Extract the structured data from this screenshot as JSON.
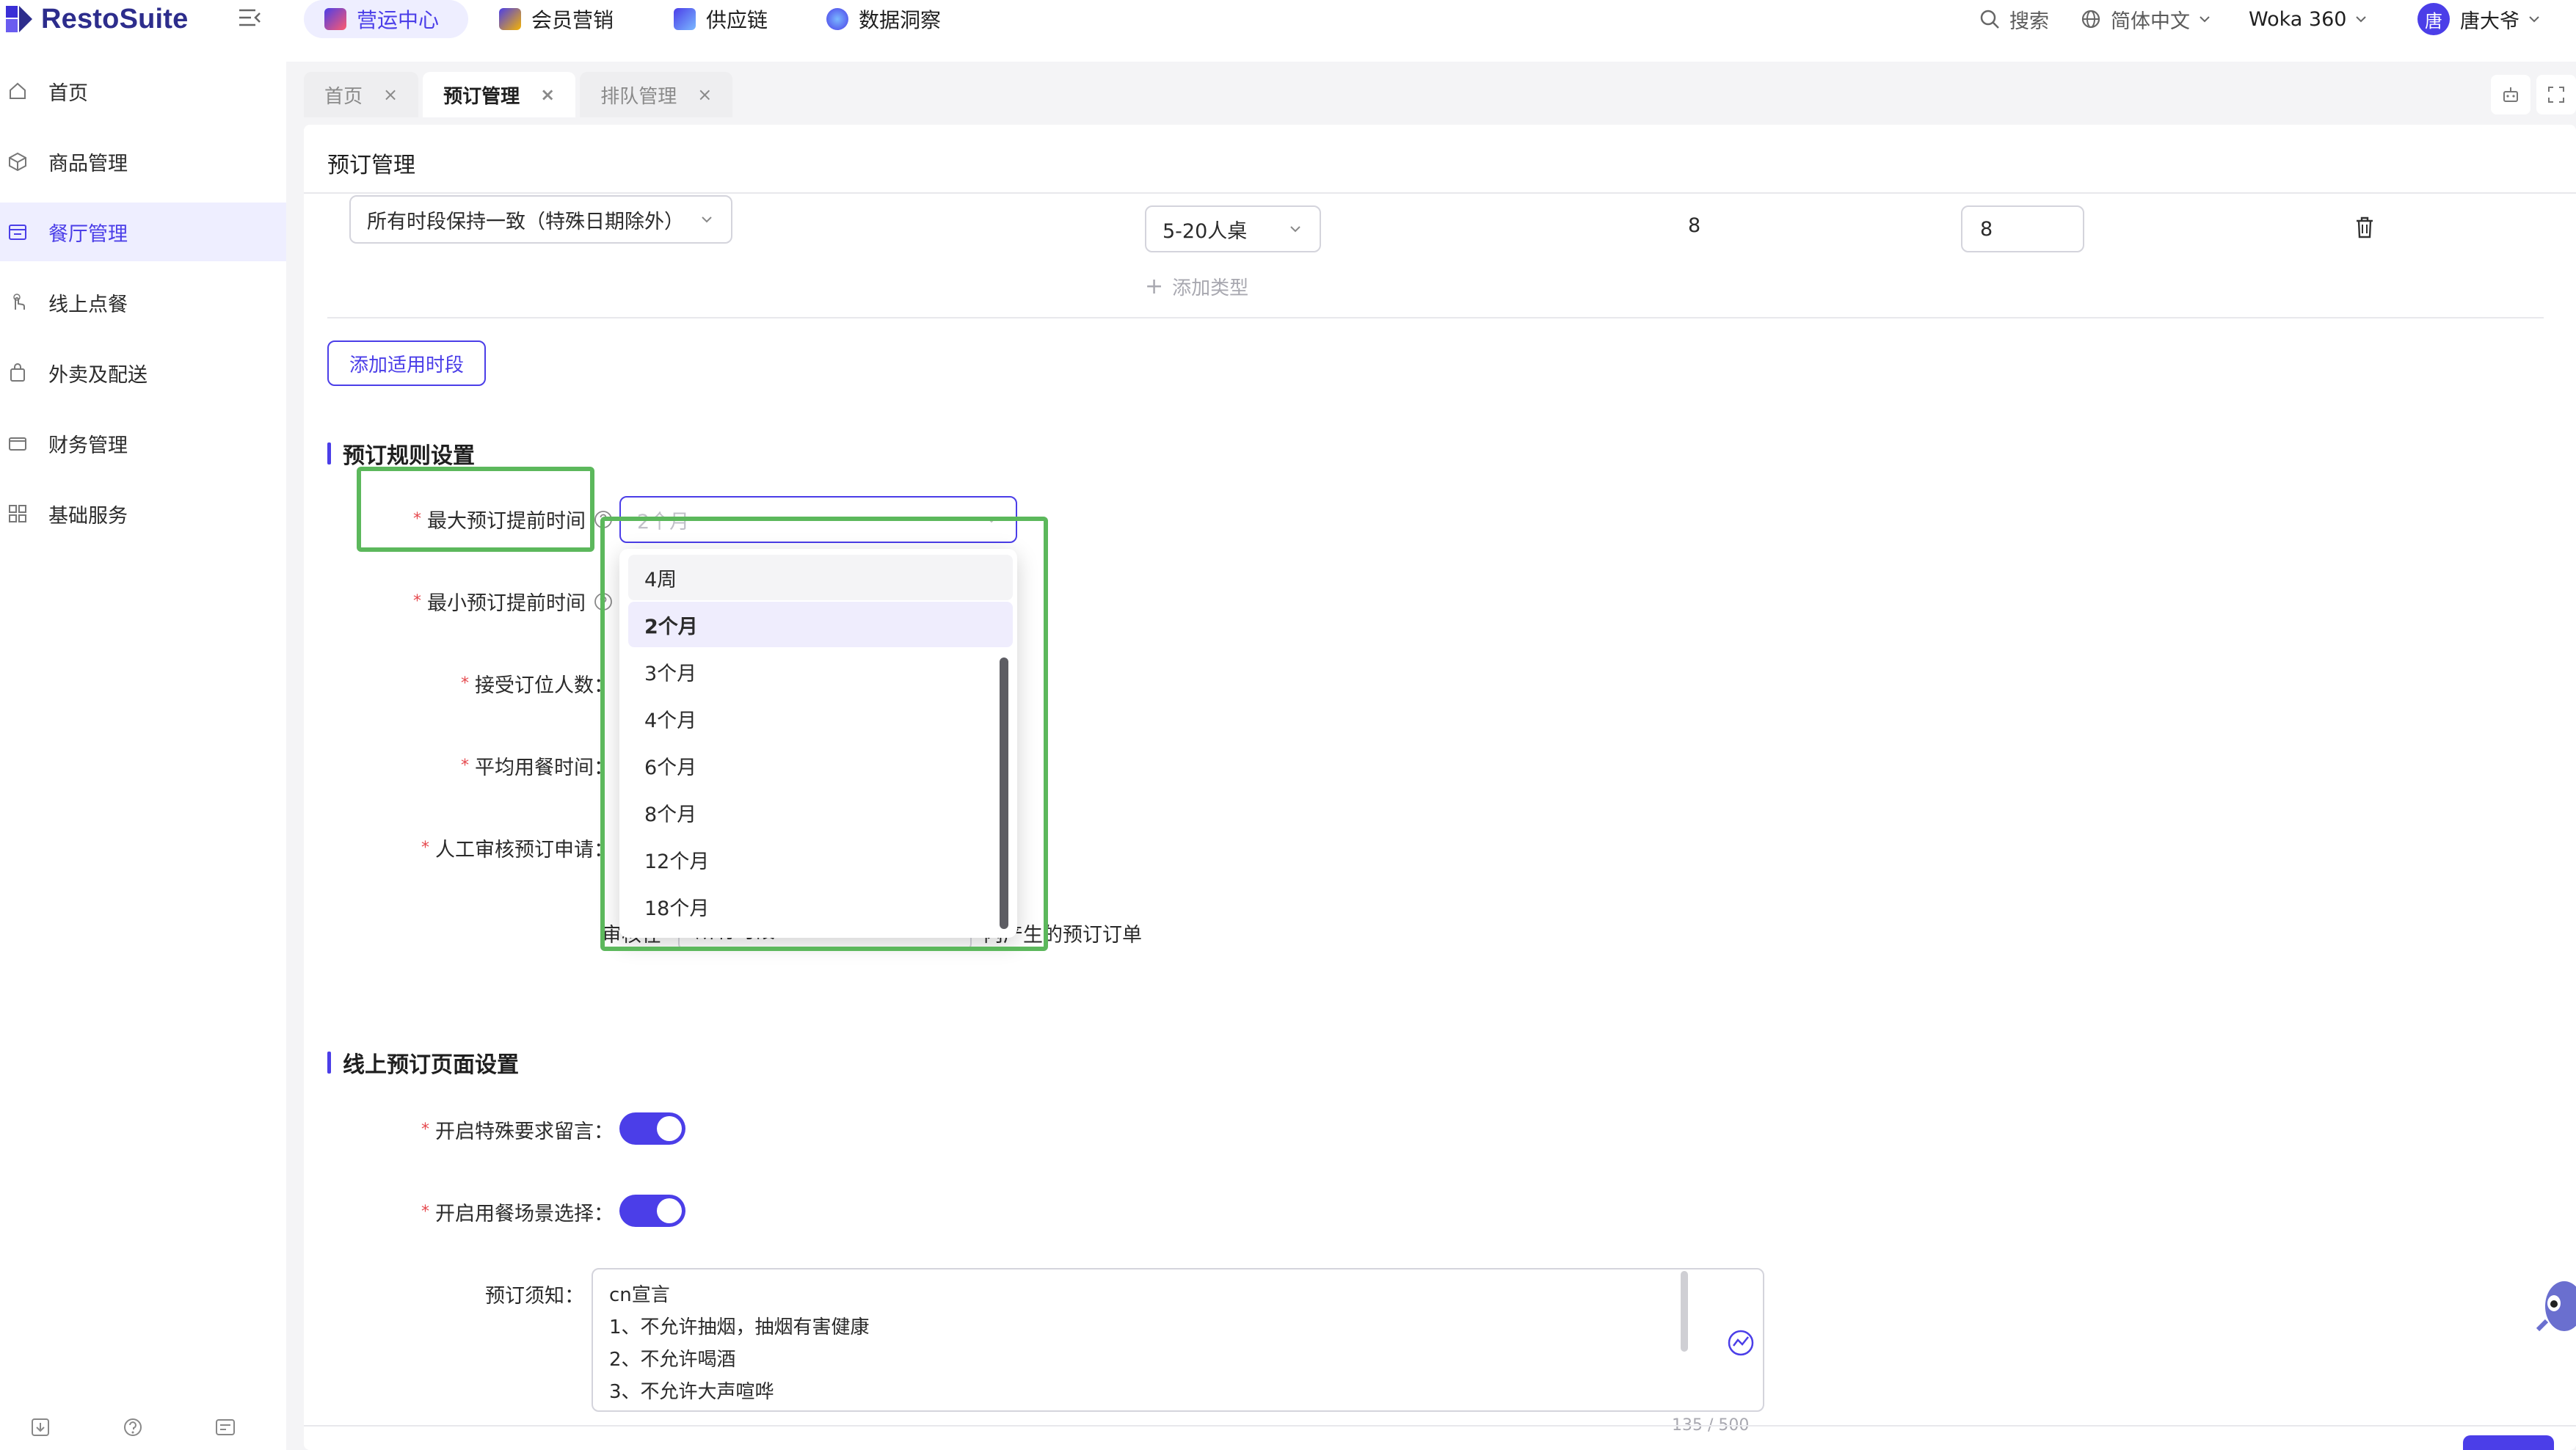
{
  "app": {
    "name": "RestoSuite"
  },
  "top_nav": [
    {
      "label": "营运中心",
      "active": true
    },
    {
      "label": "会员营销",
      "active": false
    },
    {
      "label": "供应链",
      "active": false
    },
    {
      "label": "数据洞察",
      "active": false
    }
  ],
  "top_right": {
    "search_label": "搜索",
    "language": "简体中文",
    "workspace": "Woka 360",
    "user_initial": "唐",
    "user_name": "唐大爷"
  },
  "sidebar": {
    "items": [
      {
        "label": "首页",
        "icon": "home-icon",
        "active": false
      },
      {
        "label": "商品管理",
        "icon": "box-icon",
        "active": false
      },
      {
        "label": "餐厅管理",
        "icon": "store-icon",
        "active": true
      },
      {
        "label": "线上点餐",
        "icon": "tap-icon",
        "active": false
      },
      {
        "label": "外卖及配送",
        "icon": "bag-icon",
        "active": false
      },
      {
        "label": "财务管理",
        "icon": "wallet-icon",
        "active": false
      },
      {
        "label": "基础服务",
        "icon": "grid-icon",
        "active": false
      }
    ]
  },
  "tabs": [
    {
      "label": "首页",
      "active": false,
      "close": "×"
    },
    {
      "label": "预订管理",
      "active": true,
      "close": "×"
    },
    {
      "label": "排队管理",
      "active": false,
      "close": "×"
    }
  ],
  "page": {
    "title": "预订管理",
    "period_row": {
      "period_select": "所有时段保持一致（特殊日期除外）",
      "table_type_select": "5-20人桌",
      "count_text": "8",
      "count_input": "8"
    },
    "add_type_label": "添加类型",
    "add_period_button": "添加适用时段"
  },
  "rules_section": {
    "title": "预订规则设置",
    "max_advance_label": "最大预订提前时间",
    "max_advance_value": "2个月",
    "min_advance_label": "最小预订提前时间",
    "party_size_label": "接受订位人数",
    "avg_dining_label": "平均用餐时间",
    "manual_review_label": "人工审核预订申请",
    "review_prefix": "审核在",
    "review_select": "所有时段",
    "review_suffix": "内产生的预订订单",
    "label_colon": "："
  },
  "dropdown": {
    "options": [
      "4周",
      "2个月",
      "3个月",
      "4个月",
      "6个月",
      "8个月",
      "12个月",
      "18个月"
    ],
    "selected": "2个月",
    "hovered": "4周"
  },
  "online_section": {
    "title": "线上预订页面设置",
    "special_request_label": "开启特殊要求留言：",
    "special_request_on": true,
    "scene_label": "开启用餐场景选择：",
    "scene_on": true,
    "notice_label": "预订须知：",
    "notice_lines": [
      "cn宣言",
      "1、不允许抽烟，抽烟有害健康",
      "2、不允许喝酒",
      "3、不允许大声喧哗"
    ],
    "notice_counter": "135 / 500"
  },
  "colors": {
    "accent": "#4b3ee8",
    "highlight": "#5cb85c",
    "required": "#e5484d"
  }
}
